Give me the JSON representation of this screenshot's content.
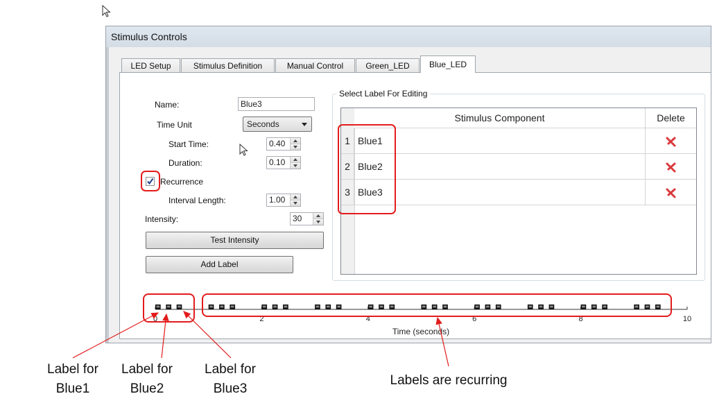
{
  "window": {
    "title": "Stimulus Controls"
  },
  "tabs": [
    {
      "label": "LED Setup",
      "active": false
    },
    {
      "label": "Stimulus Definition",
      "active": false
    },
    {
      "label": "Manual Control",
      "active": false
    },
    {
      "label": "Green_LED",
      "active": false
    },
    {
      "label": "Blue_LED",
      "active": true
    }
  ],
  "form": {
    "name_label": "Name:",
    "name_value": "Blue3",
    "time_unit_label": "Time Unit",
    "time_unit_value": "Seconds",
    "start_time_label": "Start Time:",
    "start_time_value": "0.40",
    "duration_label": "Duration:",
    "duration_value": "0.10",
    "recurrence_label": "Recurrence",
    "recurrence_checked": true,
    "interval_label": "Interval Length:",
    "interval_value": "1.00",
    "intensity_label": "Intensity:",
    "intensity_value": "30",
    "test_intensity_button": "Test Intensity",
    "add_label_button": "Add Label"
  },
  "label_group": {
    "title": "Select Label For Editing",
    "columns": [
      "Stimulus Component",
      "Delete"
    ],
    "rows": [
      {
        "index": "1",
        "component": "Blue1"
      },
      {
        "index": "2",
        "component": "Blue2"
      },
      {
        "index": "3",
        "component": "Blue3"
      }
    ]
  },
  "chart_data": {
    "type": "scatter",
    "xlabel": "Time (seconds)",
    "xlim": [
      0,
      10
    ],
    "x_ticks": [
      "0",
      "2",
      "4",
      "6",
      "8",
      "10"
    ],
    "series": [
      {
        "name": "Blue1",
        "x": [
          0.0,
          1.0,
          2.0,
          3.0,
          4.0,
          5.0,
          6.0,
          7.0,
          8.0,
          9.0
        ]
      },
      {
        "name": "Blue2",
        "x": [
          0.2,
          1.2,
          2.2,
          3.2,
          4.2,
          5.2,
          6.2,
          7.2,
          8.2,
          9.2
        ]
      },
      {
        "name": "Blue3",
        "x": [
          0.4,
          1.4,
          2.4,
          3.4,
          4.4,
          5.4,
          6.4,
          7.4,
          8.4,
          9.4
        ]
      }
    ],
    "pulse_duration": 0.1
  },
  "annotations": {
    "blue1": "Label for\nBlue1",
    "blue2": "Label for\nBlue2",
    "blue3": "Label for\nBlue3",
    "recurring": "Labels are recurring"
  },
  "colors": {
    "highlight": "#e31b1b",
    "pulse": "#111111",
    "delete_icon": "#d9393d"
  }
}
